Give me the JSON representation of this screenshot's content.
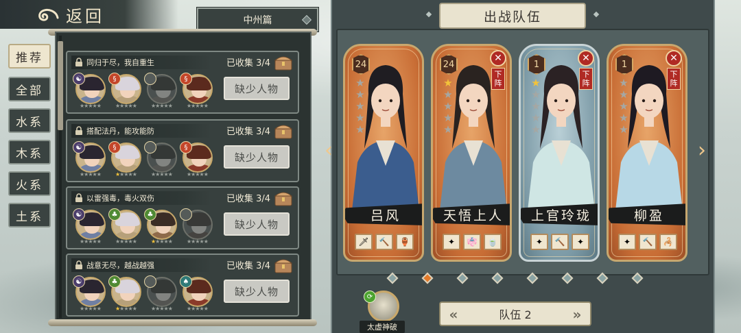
{
  "header": {
    "back_label": "返回",
    "chapter": "中州篇"
  },
  "tabs": [
    {
      "label": "推荐",
      "active": true
    },
    {
      "label": "全部",
      "active": false
    },
    {
      "label": "水系",
      "active": false
    },
    {
      "label": "木系",
      "active": false
    },
    {
      "label": "火系",
      "active": false
    },
    {
      "label": "土系",
      "active": false
    }
  ],
  "combos": [
    {
      "title": "同归于尽，我自重生",
      "collected": "已收集 3/4",
      "button": "缺少人物",
      "members": [
        {
          "element": "yin",
          "element_glyph": "☯",
          "owned": true,
          "stars": 0
        },
        {
          "element": "fire",
          "element_glyph": "§",
          "owned": true,
          "stars": 0
        },
        {
          "element": "none",
          "element_glyph": "",
          "owned": false,
          "stars": 0
        },
        {
          "element": "fire",
          "element_glyph": "§",
          "owned": true,
          "stars": 0
        }
      ]
    },
    {
      "title": "搭配法丹，能攻能防",
      "collected": "已收集 3/4",
      "button": "缺少人物",
      "members": [
        {
          "element": "yin",
          "element_glyph": "☯",
          "owned": true,
          "stars": 0
        },
        {
          "element": "fire",
          "element_glyph": "§",
          "owned": true,
          "stars": 1
        },
        {
          "element": "none",
          "element_glyph": "",
          "owned": false,
          "stars": 0
        },
        {
          "element": "fire",
          "element_glyph": "§",
          "owned": true,
          "stars": 0
        }
      ]
    },
    {
      "title": "以雷强毒，毒火双伤",
      "collected": "已收集 3/4",
      "button": "缺少人物",
      "members": [
        {
          "element": "yin",
          "element_glyph": "☯",
          "owned": true,
          "stars": 0
        },
        {
          "element": "wood",
          "element_glyph": "♣",
          "owned": true,
          "stars": 0
        },
        {
          "element": "wood",
          "element_glyph": "♣",
          "owned": true,
          "stars": 1
        },
        {
          "element": "none",
          "element_glyph": "",
          "owned": false,
          "stars": 0
        }
      ]
    },
    {
      "title": "战意无尽，越战越强",
      "collected": "已收集 3/4",
      "button": "缺少人物",
      "members": [
        {
          "element": "yin",
          "element_glyph": "☯",
          "owned": true,
          "stars": 0
        },
        {
          "element": "wood",
          "element_glyph": "♣",
          "owned": true,
          "stars": 1
        },
        {
          "element": "none",
          "element_glyph": "",
          "owned": false,
          "stars": 0
        },
        {
          "element": "water",
          "element_glyph": "♠",
          "owned": true,
          "stars": 0
        }
      ]
    }
  ],
  "team": {
    "title": "出战队伍",
    "switch_label": "队伍 2",
    "remove_label": "下阵",
    "cards": [
      {
        "name": "吕风",
        "level": "24",
        "stars": 0,
        "theme": "orange",
        "removable": false,
        "equips": [
          "🗡",
          "🔨",
          "🏺"
        ]
      },
      {
        "name": "天悟上人",
        "level": "24",
        "stars": 1,
        "theme": "orange",
        "removable": true,
        "equips": [
          "✦",
          "👘",
          "🍵"
        ]
      },
      {
        "name": "上官玲珑",
        "level": "1",
        "stars": 1,
        "theme": "blue",
        "removable": true,
        "equips": [
          "✦",
          "🔨",
          "✦"
        ]
      },
      {
        "name": "柳盈",
        "level": "1",
        "stars": 0,
        "theme": "orange",
        "removable": true,
        "equips": [
          "✦",
          "🔨",
          "🦂"
        ]
      }
    ],
    "page_dots": 8,
    "active_dot": 1,
    "skill_label": "太虚神破",
    "skill_badge": "⟳"
  }
}
